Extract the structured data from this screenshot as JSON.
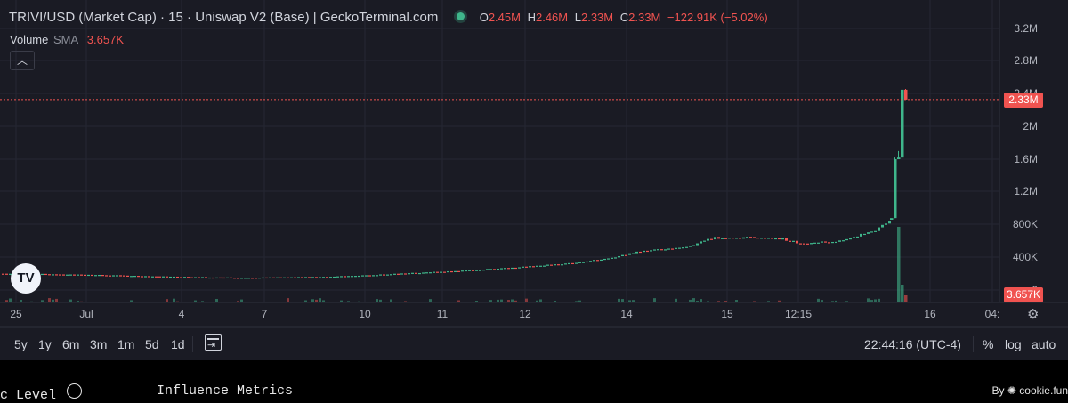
{
  "header": {
    "title": "TRIVI/USD (Market Cap) · 15 · Uniswap V2 (Base) | GeckoTerminal.com",
    "ohlc": {
      "o_label": "O",
      "o": "2.45M",
      "h_label": "H",
      "h": "2.46M",
      "l_label": "L",
      "l": "2.33M",
      "c_label": "C",
      "c": "2.33M",
      "change": "−122.91K (−5.02%)"
    }
  },
  "volume_legend": {
    "label": "Volume",
    "sma_label": "SMA",
    "value": "3.657K"
  },
  "collapse_icon": "chevron-up-icon",
  "logo_text": "TV",
  "price_badge": "2.33M",
  "volume_badge": "3.657K",
  "colors": {
    "up": "#3fb68b",
    "down": "#f05350",
    "background": "#1a1b24",
    "grid": "#252733"
  },
  "bottom_bar": {
    "ranges": [
      "5y",
      "1y",
      "6m",
      "3m",
      "1m",
      "5d",
      "1d"
    ],
    "clock": "22:44:16 (UTC-4)",
    "percent": "%",
    "log": "log",
    "auto": "auto"
  },
  "footer": {
    "left_text": "c Level",
    "middle_text": "Influence Metrics",
    "by_text": "By",
    "brand_text": "cookie.fun"
  },
  "chart_data": {
    "type": "candlestick",
    "title": "TRIVI/USD (Market Cap) · 15 · Uniswap V2 (Base) | GeckoTerminal.com",
    "y_ticks": [
      "3.2M",
      "2.8M",
      "2.4M",
      "2M",
      "1.6M",
      "1.2M",
      "800K",
      "400K",
      "0"
    ],
    "ylim": [
      0,
      3300000
    ],
    "x_ticks": [
      "25",
      "Jul",
      "4",
      "7",
      "10",
      "11",
      "12",
      "14",
      "15",
      "12:15",
      "16",
      "04:"
    ],
    "last_close": 2330000,
    "series": [
      {
        "name": "Market Cap",
        "points": [
          [
            0,
            200000
          ],
          [
            40,
            195000
          ],
          [
            80,
            190000
          ],
          [
            120,
            180000
          ],
          [
            160,
            170000
          ],
          [
            200,
            160000
          ],
          [
            240,
            155000
          ],
          [
            280,
            150000
          ],
          [
            320,
            155000
          ],
          [
            360,
            160000
          ],
          [
            400,
            175000
          ],
          [
            440,
            195000
          ],
          [
            480,
            215000
          ],
          [
            520,
            235000
          ],
          [
            560,
            265000
          ],
          [
            600,
            290000
          ],
          [
            640,
            330000
          ],
          [
            680,
            380000
          ],
          [
            720,
            480000
          ],
          [
            760,
            510000
          ],
          [
            780,
            560000
          ],
          [
            800,
            640000
          ],
          [
            840,
            640000
          ],
          [
            880,
            620000
          ],
          [
            900,
            560000
          ],
          [
            940,
            600000
          ],
          [
            980,
            720000
          ],
          [
            1000,
            860000
          ],
          [
            1008,
            1600000
          ],
          [
            1012,
            2100000
          ],
          [
            1016,
            2450000
          ],
          [
            1018,
            2330000
          ]
        ]
      }
    ],
    "volume": {
      "sma": "3.657K",
      "spike_index": 1013
    }
  }
}
